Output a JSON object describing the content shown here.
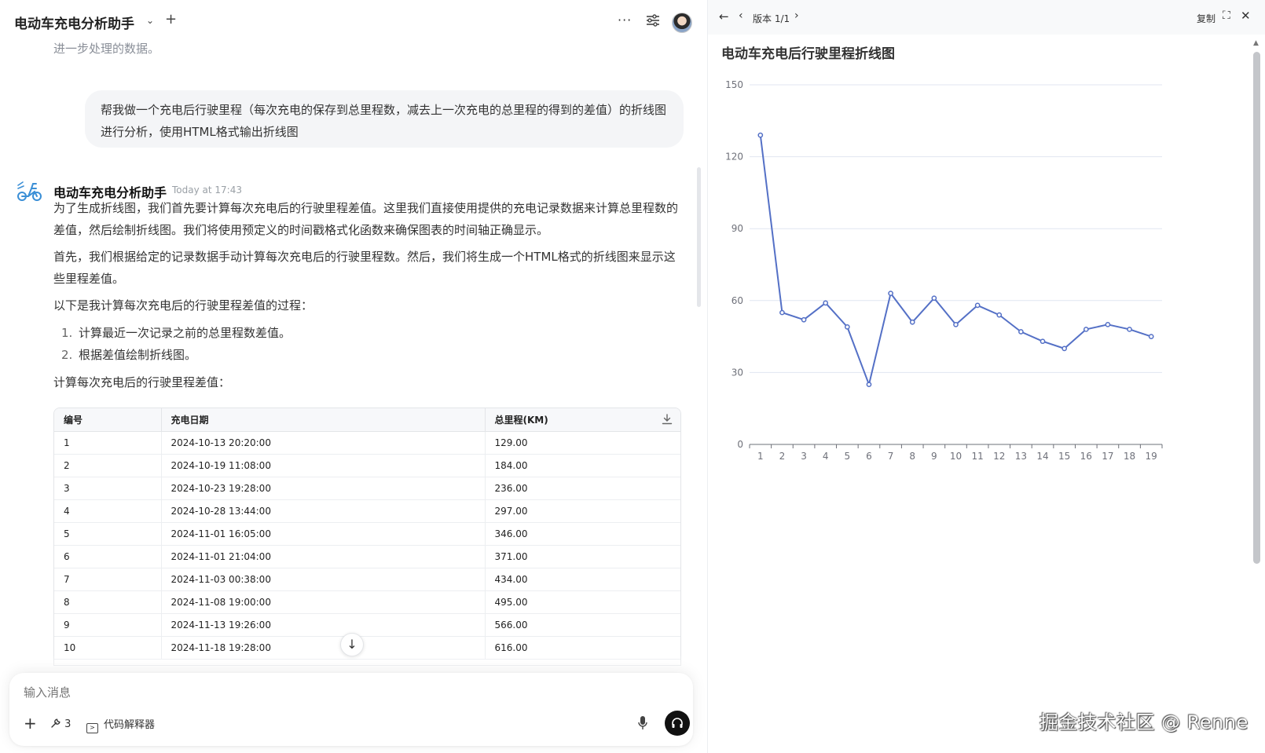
{
  "topbar": {
    "model_name": "电动车充电分析助手",
    "chevron": "⌄",
    "plus": "+",
    "more": "···"
  },
  "chat": {
    "system_line": "进一步处理的数据。",
    "user_message": "帮我做一个充电后行驶里程（每次充电的保存到总里程数，减去上一次充电的总里程的得到的差值）的折线图进行分析，使用HTML格式输出折线图",
    "bot_name": "电动车充电分析助手",
    "bot_time": "Today at 17:43",
    "paragraphs": [
      "为了生成折线图，我们首先要计算每次充电后的行驶里程差值。这里我们直接使用提供的充电记录数据来计算总里程数的差值，然后绘制折线图。我们将使用预定义的时间戳格式化函数来确保图表的时间轴正确显示。",
      "首先，我们根据给定的记录数据手动计算每次充电后的行驶里程数。然后，我们将生成一个HTML格式的折线图来显示这些里程差值。",
      "以下是我计算每次充电后的行驶里程差值的过程："
    ],
    "steps": [
      {
        "num": "1.",
        "text": "计算最近一次记录之前的总里程数差值。"
      },
      {
        "num": "2.",
        "text": "根据差值绘制折线图。"
      }
    ],
    "table_caption": "计算每次充电后的行驶里程差值：",
    "table": {
      "headers": [
        "编号",
        "充电日期",
        "总里程(KM)"
      ],
      "rows": [
        [
          "1",
          "2024-10-13 20:20:00",
          "129.00"
        ],
        [
          "2",
          "2024-10-19 11:08:00",
          "184.00"
        ],
        [
          "3",
          "2024-10-23 19:28:00",
          "236.00"
        ],
        [
          "4",
          "2024-10-28 13:44:00",
          "297.00"
        ],
        [
          "5",
          "2024-11-01 16:05:00",
          "346.00"
        ],
        [
          "6",
          "2024-11-01 21:04:00",
          "371.00"
        ],
        [
          "7",
          "2024-11-03 00:38:00",
          "434.00"
        ],
        [
          "8",
          "2024-11-08 19:00:00",
          "495.00"
        ],
        [
          "9",
          "2024-11-13 19:26:00",
          "566.00"
        ],
        [
          "10",
          "2024-11-18 19:28:00",
          "616.00"
        ]
      ]
    },
    "scroll_down": "↓"
  },
  "composer": {
    "placeholder": "输入消息",
    "plus": "+",
    "tools_count": "3",
    "interpreter_label": "代码解释器"
  },
  "artifact": {
    "version_label": "版本 1/1",
    "copy_label": "复制",
    "back": "←",
    "prev": "‹",
    "next": "›",
    "fullscreen": "⛶",
    "close": "✕"
  },
  "watermark": "掘金技术社区 @ Renne",
  "colors": {
    "line": "#5470c6",
    "grid": "#e0e6f1",
    "axis": "#6e7079"
  },
  "chart_data": {
    "type": "line",
    "title": "电动车充电后行驶里程折线图",
    "x": [
      "1",
      "2",
      "3",
      "4",
      "5",
      "6",
      "7",
      "8",
      "9",
      "10",
      "11",
      "12",
      "13",
      "14",
      "15",
      "16",
      "17",
      "18",
      "19"
    ],
    "series": [
      {
        "values": [
          129,
          55,
          52,
          59,
          49,
          25,
          63,
          51,
          61,
          50,
          58,
          54,
          47,
          43,
          40,
          48,
          50,
          48,
          45
        ]
      }
    ],
    "ylim": [
      0,
      150
    ],
    "yticks": [
      0,
      30,
      60,
      90,
      120,
      150
    ],
    "grid": true,
    "legend": "none"
  }
}
